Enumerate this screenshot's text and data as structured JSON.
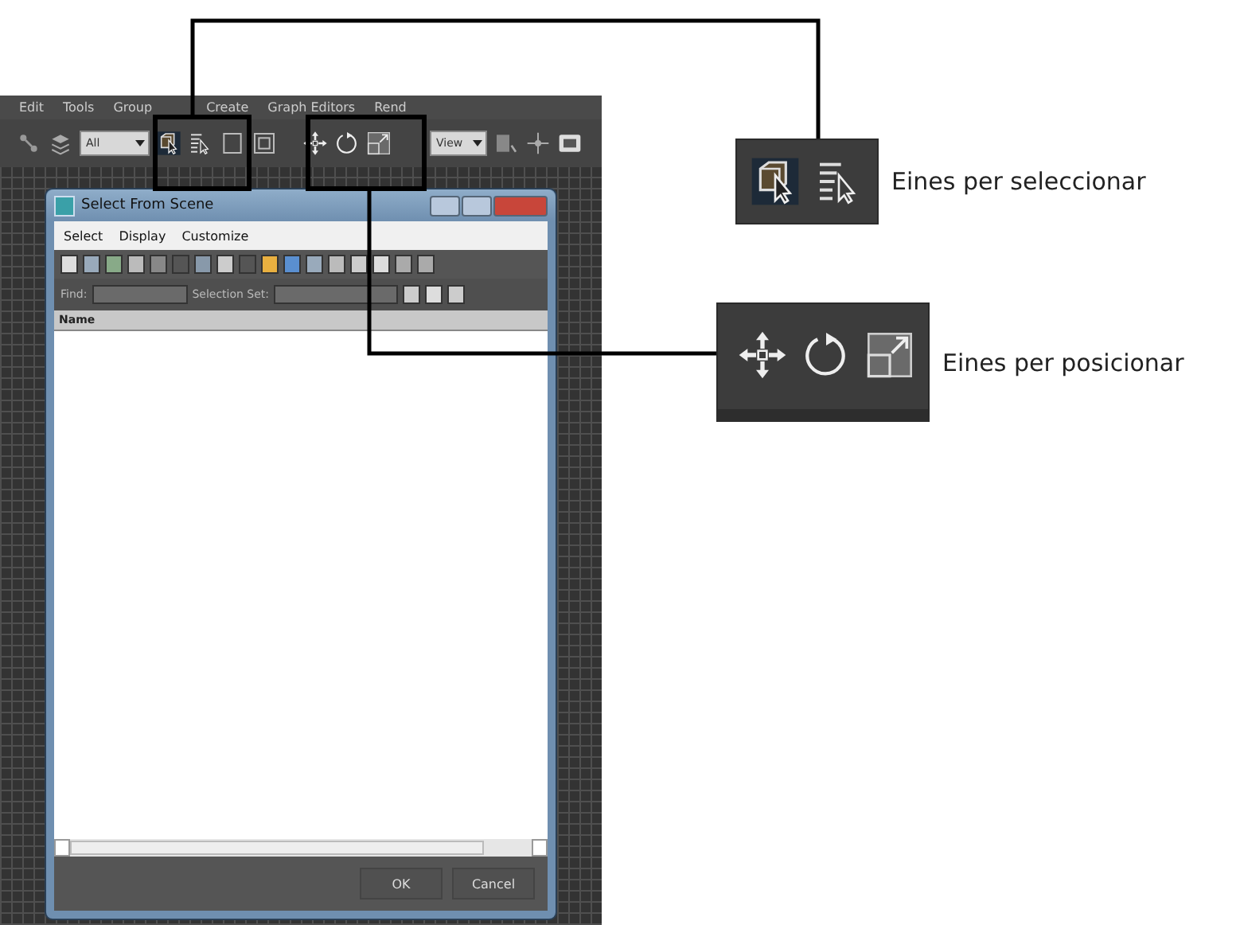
{
  "app": {
    "menu": [
      "Edit",
      "Tools",
      "Group",
      "Create",
      "Graph Editors",
      "Rend"
    ],
    "toolbar": {
      "filter": "All",
      "view": "View"
    }
  },
  "dialog": {
    "title": "Select From Scene",
    "menu": [
      "Select",
      "Display",
      "Customize"
    ],
    "find_label": "Find:",
    "selection_set_label": "Selection Set:",
    "column": "Name",
    "buttons": [
      "OK",
      "Cancel"
    ]
  },
  "callouts": [
    {
      "kind": "select",
      "label": "Eines per seleccionar"
    },
    {
      "kind": "position",
      "label": "Eines per posicionar"
    }
  ]
}
